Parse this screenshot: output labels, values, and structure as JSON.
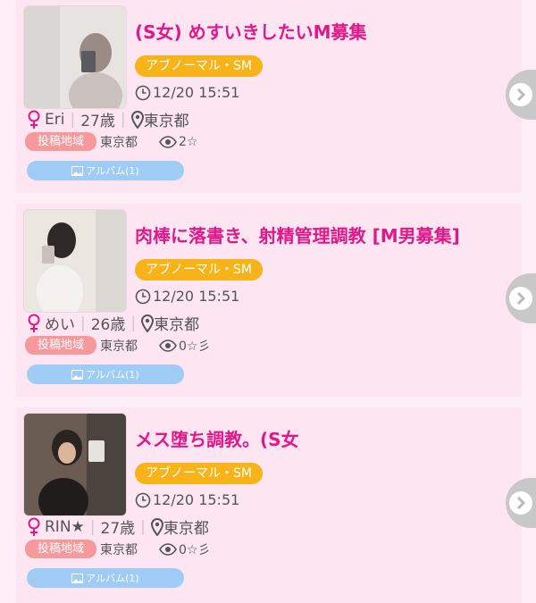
{
  "posts": [
    {
      "title": "(S女) めすいきしたいM募集",
      "category": "アブノーマル・SM",
      "time": "12/20 15:51",
      "name": "Eri",
      "age": "27歳",
      "location": "東京都",
      "region_label": "投稿地域",
      "region": "東京都",
      "views": "2☆",
      "album": "アルバム(1)"
    },
    {
      "title": "肉棒に落書き、射精管理調教 [M男募集]",
      "category": "アブノーマル・SM",
      "time": "12/20 15:51",
      "name": "めい",
      "age": "26歳",
      "location": "東京都",
      "region_label": "投稿地域",
      "region": "東京都",
      "views": "0☆彡",
      "album": "アルバム(1)"
    },
    {
      "title": "メス堕ち調教。(S女",
      "category": "アブノーマル・SM",
      "time": "12/20 15:51",
      "name": "RIN★",
      "age": "27歳",
      "location": "東京都",
      "region_label": "投稿地域",
      "region": "東京都",
      "views": "0☆彡",
      "album": "アルバム(1)"
    }
  ],
  "colors": {
    "title": "#e0198a",
    "category_bg": "#f7b318",
    "region_badge_bg": "#f5999c",
    "album_bg": "#9fccf5",
    "card_bg": "#fde6f2",
    "female_icon": "#e0198a"
  },
  "icons": [
    "clock-icon",
    "female-icon",
    "location-pin-icon",
    "eye-icon",
    "image-icon",
    "chevron-right-icon"
  ]
}
